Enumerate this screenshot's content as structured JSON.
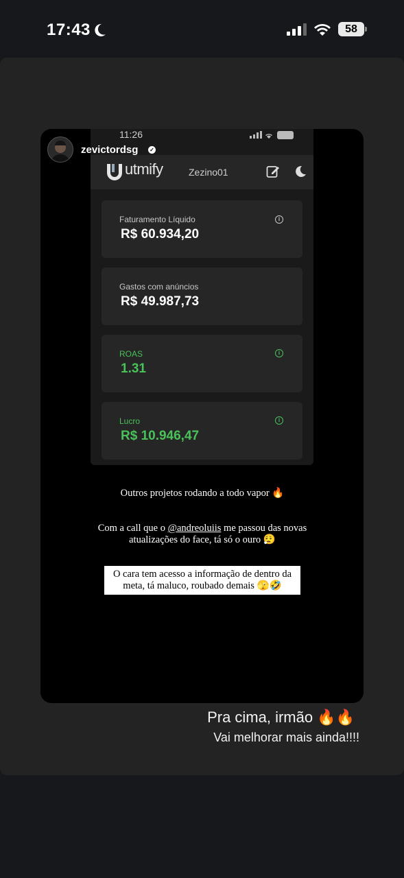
{
  "status_bar": {
    "time": "17:43",
    "battery": "58"
  },
  "story": {
    "username": "zevictordsg",
    "screenshot": {
      "time": "11:26",
      "app_name": "utmify",
      "account": "Zezino01",
      "metrics": [
        {
          "label": "Faturamento Líquido",
          "value": "R$ 60.934,20",
          "accent": "#ffffff"
        },
        {
          "label": "Gastos com anúncios",
          "value": "R$ 49.987,73",
          "accent": "#ffffff"
        },
        {
          "label": "ROAS",
          "value": "1.31",
          "accent": "#49c25a"
        },
        {
          "label": "Lucro",
          "value": "R$ 10.946,47",
          "accent": "#49c25a"
        }
      ]
    },
    "captions": {
      "line1": "Outros projetos rodando a todo vapor 🔥",
      "line2a": "Com a call que o ",
      "mention": "@andreoluiis",
      "line2b": " me passou das novas atualizações do face, tá só o ouro 😮‍💨",
      "line3": "O cara tem acesso a informação de dentro da meta, tá maluco, roubado demais 🫣🤣"
    }
  },
  "reply": {
    "line1": "Pra cima, irmão 🔥🔥",
    "line2": "Vai melhorar mais ainda!!!!"
  }
}
